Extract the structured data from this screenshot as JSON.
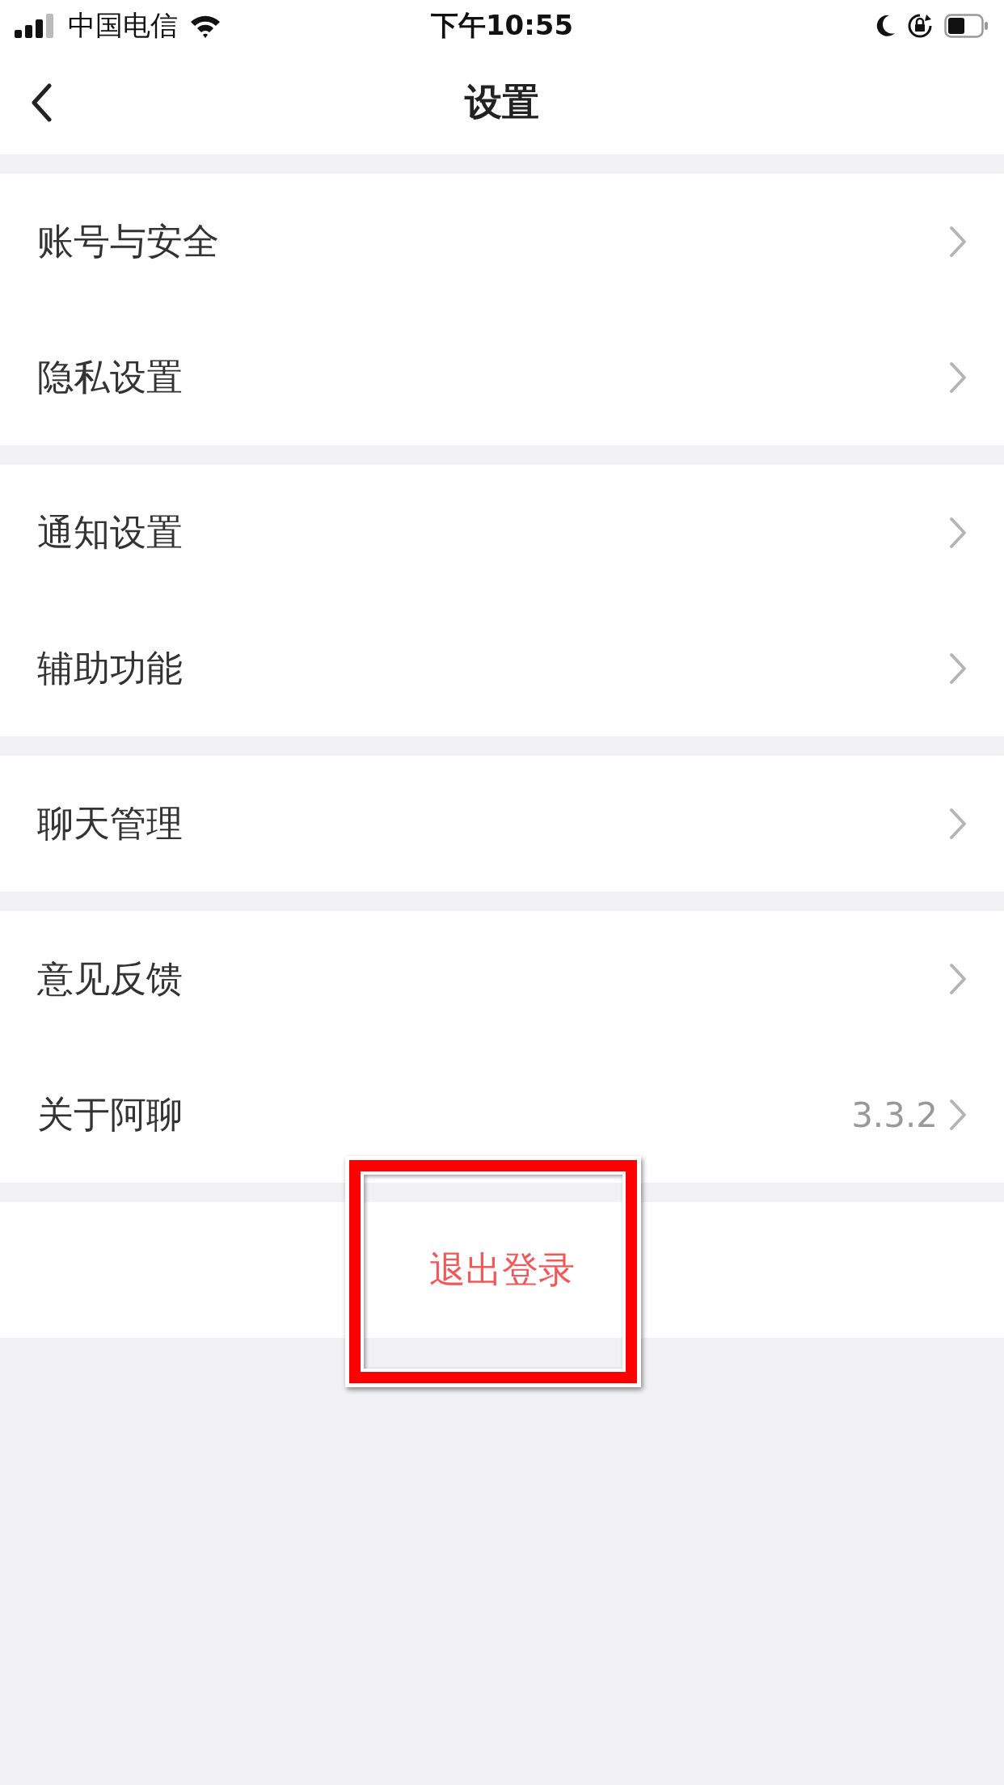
{
  "status_bar": {
    "carrier": "中国电信",
    "time": "下午10:55"
  },
  "nav": {
    "title": "设置"
  },
  "groups": [
    {
      "items": [
        {
          "label": "账号与安全"
        },
        {
          "label": "隐私设置"
        }
      ]
    },
    {
      "items": [
        {
          "label": "通知设置"
        },
        {
          "label": "辅助功能"
        }
      ]
    },
    {
      "items": [
        {
          "label": "聊天管理"
        }
      ]
    },
    {
      "items": [
        {
          "label": "意见反馈"
        },
        {
          "label": "关于阿聊",
          "value": "3.3.2"
        }
      ]
    }
  ],
  "logout": {
    "label": "退出登录"
  }
}
